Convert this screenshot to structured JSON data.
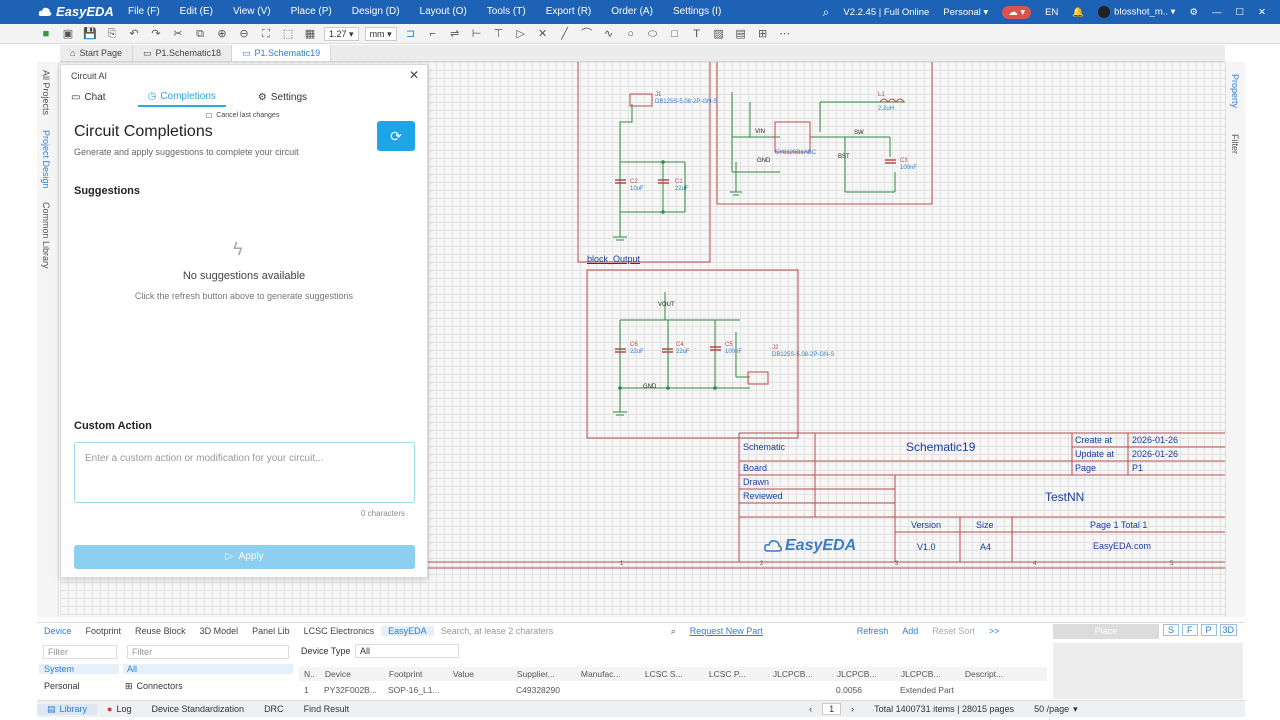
{
  "app": {
    "brand": "EasyEDA",
    "menu": [
      "File (F)",
      "Edit (E)",
      "View (V)",
      "Place (P)",
      "Design (D)",
      "Layout (O)",
      "Tools (T)",
      "Export (R)",
      "Order (A)",
      "Settings (I)"
    ],
    "version": "V2.2.45 | Full Online",
    "workspace": "Personal",
    "language": "EN",
    "user": "blosshot_m.."
  },
  "toolbar": {
    "zoom": "1.27",
    "unit": "mm"
  },
  "tabs": [
    {
      "label": "Start Page",
      "active": false
    },
    {
      "label": "P1.Schematic18",
      "active": false
    },
    {
      "label": "P1.Schematic19",
      "active": true
    }
  ],
  "left_rail": [
    "All Projects",
    "Project Design",
    "Common Library"
  ],
  "right_rail": [
    "Property",
    "Filter"
  ],
  "panel": {
    "title": "Circuit AI",
    "tabs": [
      "Chat",
      "Completions",
      "Settings"
    ],
    "active_tab": "Completions",
    "cancel_label": "Cancel last changes",
    "heading": "Circuit Completions",
    "subheading": "Generate and apply suggestions to complete your circuit",
    "suggestions_label": "Suggestions",
    "empty_title": "No suggestions available",
    "empty_hint": "Click the refresh button above to generate suggestions",
    "custom_label": "Custom Action",
    "custom_placeholder": "Enter a custom action or modification for your circuit...",
    "char_count": "0 characters",
    "apply_label": "Apply"
  },
  "schematic": {
    "block_label": "block_Output",
    "parts": {
      "j1": "J1",
      "j1_val": "DB125S-5.08-2P-GN-S",
      "c2": "C2",
      "c2_val": "10uF",
      "c1": "C1",
      "c1_val": "22uF",
      "u1_val": "SY8120B1ABC",
      "l1": "L1",
      "l1_val": "2.2uH",
      "c3": "C3",
      "c3_val": "100nF",
      "c6": "C6",
      "c6_val": "22uF",
      "c4": "C4",
      "c4_val": "22uF",
      "c5": "C5",
      "c5_val": "100nF",
      "j2": "J2",
      "j2_val": "DB125S-5.08-2P-GN-S",
      "gnd": "GND",
      "vout": "VOUT",
      "vin": "VIN",
      "bst": "BST",
      "sw": "SW"
    },
    "title_block": {
      "schematic_label": "Schematic",
      "schematic_value": "Schematic19",
      "board_label": "Board",
      "drawn_label": "Drawn",
      "reviewed_label": "Reviewed",
      "create_label": "Create at",
      "create_value": "2026-01-26",
      "update_label": "Update at",
      "update_value": "2026-01-26",
      "page_label": "Page",
      "page_value": "P1",
      "project": "TestNN",
      "version_label": "Version",
      "version_value": "V1.0",
      "size_label": "Size",
      "size_value": "A4",
      "page_total": "Page  1  Total  1",
      "site": "EasyEDA.com",
      "logo": "EasyEDA"
    },
    "ruler": [
      "1",
      "2",
      "3",
      "4",
      "5",
      "6"
    ]
  },
  "bottom": {
    "tabs": [
      "Device",
      "Footprint",
      "Reuse Block",
      "3D Model",
      "Panel Lib",
      "LCSC Electronics",
      "EasyEDA"
    ],
    "search_placeholder": "Search, at lease 2 charaters",
    "request": "Request New Part",
    "refresh": "Refresh",
    "add": "Add",
    "reset": "Reset Sort",
    "more": ">>",
    "place": "Place",
    "view_btns": [
      "S",
      "F",
      "P",
      "3D"
    ],
    "filter_placeholder": "Filter",
    "library_types": [
      "System",
      "Personal"
    ],
    "categories": [
      "All",
      "Connectors"
    ],
    "device_type_label": "Device Type",
    "device_type_value": "All",
    "columns": [
      "N..",
      "Device",
      "Footprint",
      "Value",
      "Supplier...",
      "Manufac...",
      "LCSC S...",
      "LCSC P...",
      "JLCPCB...",
      "JLCPCB...",
      "JLCPCB...",
      "Descript..."
    ],
    "row": [
      "1",
      "PY32F002B...",
      "SOP-16_L1...",
      "",
      "C49328290",
      "",
      "",
      "",
      "",
      "0.0056",
      "Extended Part",
      ""
    ]
  },
  "status": {
    "items": [
      "Library",
      "Log",
      "Device Standardization",
      "DRC",
      "Find Result"
    ],
    "page": "1",
    "total": "Total 1400731 items | 28015 pages",
    "per_page": "50 /page"
  }
}
